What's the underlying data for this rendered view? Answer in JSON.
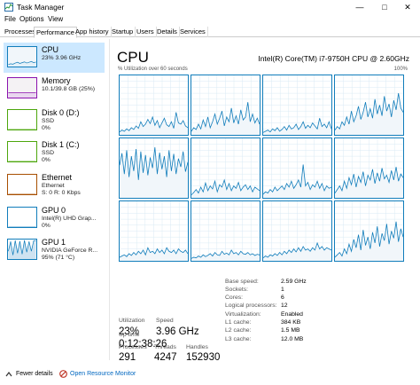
{
  "window": {
    "title": "Task Manager"
  },
  "menu": [
    "File",
    "Options",
    "View"
  ],
  "tabs": [
    "Processes",
    "Performance",
    "App history",
    "Startup",
    "Users",
    "Details",
    "Services"
  ],
  "active_tab": "Performance",
  "sidebar": [
    {
      "name": "CPU",
      "line1": "23%  3.96 GHz",
      "line2": "",
      "color": "#117dbb",
      "fill": "#f1f6fa"
    },
    {
      "name": "Memory",
      "line1": "10.1/39.8 GB (25%)",
      "line2": "",
      "color": "#8b12ae",
      "fill": "#f4f2f4"
    },
    {
      "name": "Disk 0 (D:)",
      "line1": "SSD",
      "line2": "0%",
      "color": "#4da60c",
      "fill": "#fff"
    },
    {
      "name": "Disk 1 (C:)",
      "line1": "SSD",
      "line2": "0%",
      "color": "#4da60c",
      "fill": "#fff"
    },
    {
      "name": "Ethernet",
      "line1": "Ethernet",
      "line2": "S: 0  R: 0 Kbps",
      "color": "#a74f01",
      "fill": "#fff"
    },
    {
      "name": "GPU 0",
      "line1": "Intel(R) UHD Grap...",
      "line2": "0%",
      "color": "#117dbb",
      "fill": "#fff"
    },
    {
      "name": "GPU 1",
      "line1": "NVIDIA GeForce R...",
      "line2": "95% (71 °C)",
      "color": "#117dbb",
      "fill": "#fff"
    }
  ],
  "main": {
    "title": "CPU",
    "model": "Intel(R) Core(TM) i7-9750H CPU @ 2.60GHz",
    "graph_label": "% Utilization over 60 seconds",
    "graph_max": "100%"
  },
  "stats": {
    "utilization_label": "Utilization",
    "utilization": "23%",
    "speed_label": "Speed",
    "speed": "3.96 GHz",
    "processes_label": "Processes",
    "processes": "291",
    "threads_label": "Threads",
    "threads": "4247",
    "handles_label": "Handles",
    "handles": "152930",
    "uptime_label": "Up time",
    "uptime": "0:12:38:26"
  },
  "specs": [
    {
      "label": "Base speed:",
      "value": "2.59 GHz"
    },
    {
      "label": "Sockets:",
      "value": "1"
    },
    {
      "label": "Cores:",
      "value": "6"
    },
    {
      "label": "Logical processors:",
      "value": "12"
    },
    {
      "label": "Virtualization:",
      "value": "Enabled"
    },
    {
      "label": "L1 cache:",
      "value": "384 KB"
    },
    {
      "label": "L2 cache:",
      "value": "1.5 MB"
    },
    {
      "label": "L3 cache:",
      "value": "12.0 MB"
    }
  ],
  "footer": {
    "fewer": "Fewer details",
    "monitor": "Open Resource Monitor"
  },
  "cores": [
    [
      5,
      8,
      6,
      10,
      7,
      12,
      9,
      15,
      11,
      22,
      14,
      18,
      26,
      19,
      30,
      16,
      24,
      12,
      20,
      28,
      17,
      14,
      22,
      11,
      38,
      20,
      18,
      24,
      15,
      12
    ],
    [
      6,
      12,
      9,
      18,
      10,
      25,
      14,
      30,
      12,
      22,
      35,
      18,
      28,
      40,
      15,
      30,
      22,
      45,
      20,
      32,
      18,
      42,
      25,
      30,
      55,
      22,
      35,
      20,
      28,
      18
    ],
    [
      4,
      6,
      8,
      5,
      10,
      7,
      12,
      6,
      9,
      14,
      8,
      16,
      10,
      12,
      18,
      9,
      14,
      22,
      11,
      16,
      12,
      20,
      15,
      10,
      28,
      14,
      18,
      12,
      22,
      10
    ],
    [
      8,
      14,
      10,
      22,
      16,
      30,
      18,
      40,
      22,
      32,
      48,
      26,
      38,
      55,
      30,
      44,
      28,
      60,
      35,
      50,
      32,
      65,
      40,
      52,
      30,
      58,
      42,
      70,
      45,
      38
    ],
    [
      55,
      75,
      40,
      80,
      35,
      70,
      45,
      82,
      30,
      78,
      42,
      72,
      38,
      68,
      50,
      85,
      40,
      76,
      48,
      70,
      35,
      80,
      45,
      74,
      40,
      66,
      52,
      78,
      44,
      60
    ],
    [
      5,
      9,
      14,
      8,
      18,
      10,
      25,
      12,
      20,
      15,
      28,
      10,
      22,
      18,
      30,
      14,
      24,
      12,
      20,
      16,
      26,
      12,
      18,
      22,
      14,
      20,
      10,
      18,
      15,
      12
    ],
    [
      6,
      10,
      8,
      14,
      10,
      18,
      12,
      16,
      20,
      14,
      24,
      18,
      28,
      16,
      22,
      30,
      18,
      56,
      20,
      26,
      14,
      22,
      18,
      28,
      16,
      24,
      12,
      20,
      16,
      18
    ],
    [
      8,
      14,
      20,
      12,
      28,
      16,
      34,
      22,
      40,
      18,
      36,
      26,
      44,
      20,
      38,
      30,
      48,
      24,
      42,
      28,
      50,
      32,
      38,
      26,
      46,
      30,
      52,
      28,
      40,
      34
    ],
    [
      6,
      8,
      10,
      7,
      12,
      9,
      14,
      10,
      16,
      12,
      18,
      10,
      22,
      14,
      16,
      12,
      20,
      14,
      18,
      12,
      22,
      16,
      14,
      18,
      12,
      20,
      16,
      14,
      18,
      12
    ],
    [
      4,
      6,
      5,
      8,
      6,
      10,
      7,
      9,
      12,
      8,
      14,
      10,
      9,
      16,
      11,
      13,
      10,
      18,
      12,
      14,
      10,
      16,
      12,
      11,
      14,
      10,
      12,
      9,
      11,
      10
    ],
    [
      5,
      8,
      6,
      10,
      8,
      12,
      9,
      14,
      10,
      16,
      12,
      18,
      14,
      20,
      15,
      22,
      16,
      24,
      18,
      20,
      16,
      22,
      18,
      30,
      20,
      24,
      18,
      22,
      20,
      18
    ],
    [
      6,
      10,
      14,
      8,
      20,
      12,
      28,
      16,
      36,
      22,
      44,
      18,
      52,
      26,
      40,
      20,
      48,
      30,
      58,
      24,
      46,
      34,
      62,
      28,
      50,
      38,
      66,
      32,
      54,
      40
    ]
  ]
}
